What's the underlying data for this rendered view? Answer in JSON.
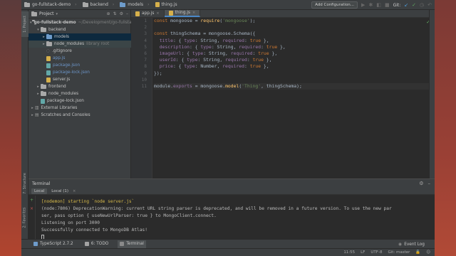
{
  "breadcrumbs": [
    {
      "label": "go-fullstack-demo",
      "icon": "folder-icon"
    },
    {
      "label": "backend",
      "icon": "folder-icon"
    },
    {
      "label": "models",
      "icon": "folder-icon"
    },
    {
      "label": "thing.js",
      "icon": "js-file-icon"
    }
  ],
  "toolbar": {
    "add_configuration": "Add Configuration...",
    "git_label": "Git:"
  },
  "project": {
    "title": "Project",
    "tree": [
      {
        "label": "go-fullstack-demo",
        "hint": "~/Development/go-fullstack-demo",
        "depth": 0,
        "expanded": true,
        "kind": "folder"
      },
      {
        "label": "backend",
        "hint": "",
        "depth": 1,
        "expanded": true,
        "kind": "folder"
      },
      {
        "label": "models",
        "hint": "",
        "depth": 2,
        "expanded": true,
        "kind": "folder-blue"
      },
      {
        "label": "node_modules",
        "hint": "library root",
        "depth": 2,
        "expanded": false,
        "kind": "folder"
      },
      {
        "label": ".gitignore",
        "hint": "",
        "depth": 2,
        "kind": "file"
      },
      {
        "label": "app.js",
        "hint": "",
        "depth": 2,
        "kind": "js"
      },
      {
        "label": "package.json",
        "hint": "",
        "depth": 2,
        "kind": "json"
      },
      {
        "label": "package-lock.json",
        "hint": "",
        "depth": 2,
        "kind": "json"
      },
      {
        "label": "server.js",
        "hint": "",
        "depth": 2,
        "kind": "js"
      },
      {
        "label": "frontend",
        "hint": "",
        "depth": 1,
        "expanded": false,
        "kind": "folder"
      },
      {
        "label": "node_modules",
        "hint": "",
        "depth": 1,
        "expanded": false,
        "kind": "folder"
      },
      {
        "label": "package-lock.json",
        "hint": "",
        "depth": 1,
        "kind": "file"
      },
      {
        "label": "External Libraries",
        "hint": "",
        "depth": 0,
        "expanded": false,
        "kind": "library"
      },
      {
        "label": "Scratches and Consoles",
        "hint": "",
        "depth": 0,
        "expanded": false,
        "kind": "scratch"
      }
    ]
  },
  "tabs": [
    {
      "label": "app.js",
      "active": false
    },
    {
      "label": "thing.js",
      "active": true
    }
  ],
  "editor": {
    "line_numbers": [
      "1",
      "2",
      "3",
      "4",
      "5",
      "6",
      "7",
      "8",
      "9",
      "10",
      "11"
    ],
    "lines": [
      [
        {
          "t": "const ",
          "c": "k"
        },
        {
          "t": "mongoose = ",
          "c": ""
        },
        {
          "t": "require",
          "c": "f"
        },
        {
          "t": "(",
          "c": ""
        },
        {
          "t": "'mongoose'",
          "c": "s"
        },
        {
          "t": ");",
          "c": ""
        }
      ],
      [],
      [
        {
          "t": "const ",
          "c": "k"
        },
        {
          "t": "thingSchema = mongoose.",
          "c": ""
        },
        {
          "t": "Schema",
          "c": ""
        },
        {
          "t": "({",
          "c": ""
        }
      ],
      [
        {
          "t": "  title",
          "c": "p"
        },
        {
          "t": ": { ",
          "c": ""
        },
        {
          "t": "type",
          "c": "p"
        },
        {
          "t": ": String, ",
          "c": ""
        },
        {
          "t": "required",
          "c": "p"
        },
        {
          "t": ": ",
          "c": ""
        },
        {
          "t": "true",
          "c": "k"
        },
        {
          "t": " },",
          "c": ""
        }
      ],
      [
        {
          "t": "  description",
          "c": "p"
        },
        {
          "t": ": { ",
          "c": ""
        },
        {
          "t": "type",
          "c": "p"
        },
        {
          "t": ": String, ",
          "c": ""
        },
        {
          "t": "required",
          "c": "p"
        },
        {
          "t": ": ",
          "c": ""
        },
        {
          "t": "true",
          "c": "k"
        },
        {
          "t": " },",
          "c": ""
        }
      ],
      [
        {
          "t": "  imageUrl",
          "c": "p"
        },
        {
          "t": ": { ",
          "c": ""
        },
        {
          "t": "type",
          "c": "p"
        },
        {
          "t": ": String, ",
          "c": ""
        },
        {
          "t": "required",
          "c": "p"
        },
        {
          "t": ": ",
          "c": ""
        },
        {
          "t": "true",
          "c": "k"
        },
        {
          "t": " },",
          "c": ""
        }
      ],
      [
        {
          "t": "  userId",
          "c": "p"
        },
        {
          "t": ": { ",
          "c": ""
        },
        {
          "t": "type",
          "c": "p"
        },
        {
          "t": ": String, ",
          "c": ""
        },
        {
          "t": "required",
          "c": "p"
        },
        {
          "t": ": ",
          "c": ""
        },
        {
          "t": "true",
          "c": "k"
        },
        {
          "t": " },",
          "c": ""
        }
      ],
      [
        {
          "t": "  price",
          "c": "p"
        },
        {
          "t": ": { ",
          "c": ""
        },
        {
          "t": "type",
          "c": "p"
        },
        {
          "t": ": Number, ",
          "c": ""
        },
        {
          "t": "required",
          "c": "p"
        },
        {
          "t": ": ",
          "c": ""
        },
        {
          "t": "true",
          "c": "k"
        },
        {
          "t": " },",
          "c": ""
        }
      ],
      [
        {
          "t": "});",
          "c": ""
        }
      ],
      [],
      [
        {
          "t": "module",
          "c": ""
        },
        {
          "t": ".",
          "c": ""
        },
        {
          "t": "exports",
          "c": "p"
        },
        {
          "t": " = mongoose.",
          "c": ""
        },
        {
          "t": "model",
          "c": "f"
        },
        {
          "t": "(",
          "c": ""
        },
        {
          "t": "'Thing'",
          "c": "s"
        },
        {
          "t": ", thingSchema);",
          "c": ""
        }
      ]
    ],
    "current_line": 11
  },
  "left_strip": {
    "project": "1: Project",
    "structure": "7: Structure",
    "favorites": "2: Favorites"
  },
  "terminal": {
    "title": "Terminal",
    "tabs": [
      {
        "label": "Local",
        "active": true
      },
      {
        "label": "Local (1)",
        "active": false
      }
    ],
    "lines": [
      {
        "text": "[nodemon] starting `node server.js`",
        "color": "yellow"
      },
      {
        "text": "(node:7806) DeprecationWarning: current URL string parser is deprecated, and will be removed in a future version. To use the new par",
        "color": ""
      },
      {
        "text": "ser, pass option { useNewUrlParser: true } to MongoClient.connect.",
        "color": ""
      },
      {
        "text": "Listening on port 3000",
        "color": ""
      },
      {
        "text": "Successfully connected to MongoDB Atlas!",
        "color": ""
      }
    ]
  },
  "tool_windows": [
    {
      "label": "TypeScript 2.7.2",
      "icon": "typescript-icon",
      "active": false
    },
    {
      "label": "6: TODO",
      "icon": "todo-icon",
      "active": false
    },
    {
      "label": "Terminal",
      "icon": "terminal-icon",
      "active": true
    }
  ],
  "event_log": "Event Log",
  "status": {
    "position": "11:55",
    "line_sep": "LF",
    "encoding": "UTF-8",
    "git_branch": "Git: master"
  }
}
